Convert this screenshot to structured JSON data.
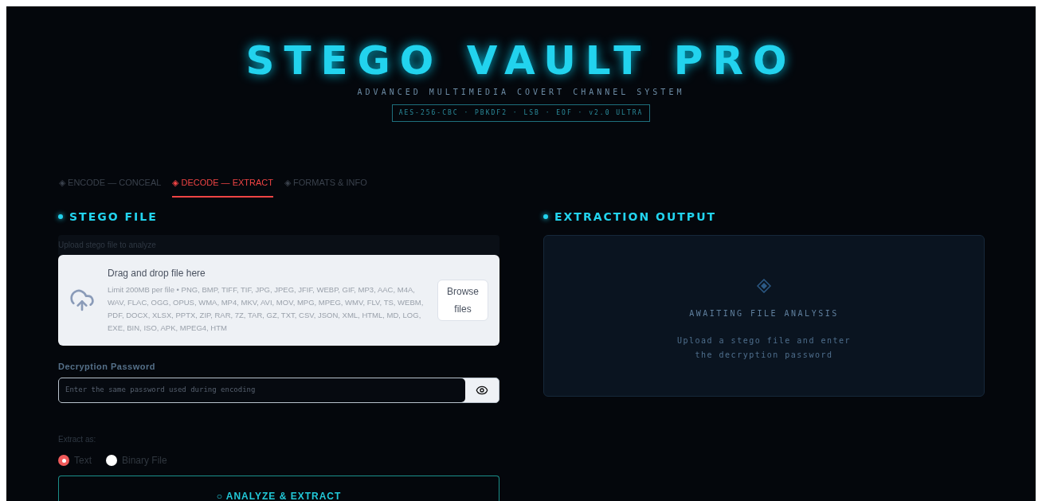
{
  "header": {
    "title": "STEGO VAULT PRO",
    "subtitle": "ADVANCED MULTIMEDIA COVERT CHANNEL SYSTEM",
    "badge": "AES-256-CBC · PBKDF2 · LSB · EOF · v2.0 ULTRA"
  },
  "tabs": [
    {
      "label": "◈ ENCODE — CONCEAL",
      "selected": false
    },
    {
      "label": "◈ DECODE — EXTRACT",
      "selected": true
    },
    {
      "label": "◈ FORMATS & INFO",
      "selected": false
    }
  ],
  "stego_file": {
    "heading": "STEGO FILE",
    "upload_label": "Upload stego file to analyze",
    "dropzone_title": "Drag and drop file here",
    "dropzone_hint": "Limit 200MB per file • PNG, BMP, TIFF, TIF, JPG, JPEG, JFIF, WEBP, GIF, MP3, AAC, M4A, WAV, FLAC, OGG, OPUS, WMA, MP4, MKV, AVI, MOV, MPG, MPEG, WMV, FLV, TS, WEBM, PDF, DOCX, XLSX, PPTX, ZIP, RAR, 7Z, TAR, GZ, TXT, CSV, JSON, XML, HTML, MD, LOG, EXE, BIN, ISO, APK, MPEG4, HTM",
    "browse_button": "Browse files"
  },
  "password": {
    "label": "Decryption Password",
    "placeholder": "Enter the same password used during encoding"
  },
  "extract_as": {
    "label": "Extract as:",
    "options": [
      {
        "label": "Text",
        "selected": true
      },
      {
        "label": "Binary File",
        "selected": false
      }
    ]
  },
  "action_button": "○ ANALYZE & EXTRACT",
  "output": {
    "heading": "EXTRACTION OUTPUT",
    "status": "AWAITING FILE ANALYSIS",
    "hint": "Upload a stego file and enter the decryption password"
  }
}
